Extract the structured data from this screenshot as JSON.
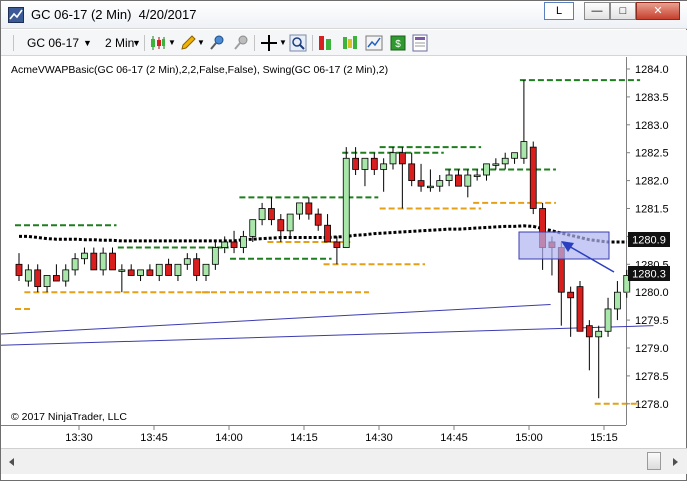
{
  "window": {
    "title": "GC 06-17 (2 Min)  4/20/2017",
    "buttons": {
      "layout": "L",
      "minimize": "—",
      "maximize": "□",
      "close": "✕"
    }
  },
  "toolbar": {
    "instrument": "GC 06-17",
    "interval": "2 Min",
    "icons": [
      "candlestick-style-icon",
      "pencil-draw-icon",
      "attach-indicator-icon",
      "detach-icon",
      "crosshair-icon",
      "zoom-icon",
      "indicators-icon",
      "strategies-icon",
      "chart-trader-icon",
      "data-box-icon",
      "properties-icon"
    ]
  },
  "chart": {
    "indicator_label": "AcmeVWAPBasic(GC 06-17 (2 Min),2,2,False,False), Swing(GC 06-17 (2 Min),2)",
    "copyright": "© 2017 NinjaTrader, LLC",
    "price_labels": [
      "1284.0",
      "1283.5",
      "1283.0",
      "1282.5",
      "1282.0",
      "1281.5",
      "1281.0",
      "1280.5",
      "1280.0",
      "1279.5",
      "1279.0",
      "1278.5",
      "1278.0"
    ],
    "time_labels": [
      "13:30",
      "13:45",
      "14:00",
      "14:15",
      "14:30",
      "14:45",
      "15:00",
      "15:15"
    ],
    "vwap_marker": "1280.9",
    "last_price_marker": "1280.3",
    "colors": {
      "up_candle": "#a9e6a9",
      "down_candle": "#d91e1e",
      "swing_high": "#1e7d1e",
      "swing_low": "#e6a017",
      "vwap": "#000000",
      "band_line": "#3b3bb0",
      "highlight_rect": "#aeb4f0"
    }
  },
  "chart_data": {
    "type": "candlestick",
    "instrument": "GC 06-17",
    "x_labels": [
      "13:30",
      "13:45",
      "14:00",
      "14:15",
      "14:30",
      "14:45",
      "15:00",
      "15:15"
    ],
    "ylim": [
      1277.8,
      1284.2
    ],
    "candles": [
      {
        "o": 1280.5,
        "h": 1280.7,
        "l": 1280.2,
        "c": 1280.3
      },
      {
        "o": 1280.2,
        "h": 1280.5,
        "l": 1280.1,
        "c": 1280.4
      },
      {
        "o": 1280.4,
        "h": 1280.5,
        "l": 1280.0,
        "c": 1280.1
      },
      {
        "o": 1280.1,
        "h": 1280.3,
        "l": 1280.0,
        "c": 1280.3
      },
      {
        "o": 1280.3,
        "h": 1280.5,
        "l": 1280.2,
        "c": 1280.2
      },
      {
        "o": 1280.2,
        "h": 1280.5,
        "l": 1280.1,
        "c": 1280.4
      },
      {
        "o": 1280.4,
        "h": 1280.7,
        "l": 1280.3,
        "c": 1280.6
      },
      {
        "o": 1280.6,
        "h": 1280.8,
        "l": 1280.5,
        "c": 1280.7
      },
      {
        "o": 1280.7,
        "h": 1280.8,
        "l": 1280.4,
        "c": 1280.4
      },
      {
        "o": 1280.4,
        "h": 1280.8,
        "l": 1280.3,
        "c": 1280.7
      },
      {
        "o": 1280.7,
        "h": 1280.8,
        "l": 1280.4,
        "c": 1280.4
      },
      {
        "o": 1280.4,
        "h": 1280.5,
        "l": 1280.0,
        "c": 1280.4
      },
      {
        "o": 1280.4,
        "h": 1280.5,
        "l": 1280.3,
        "c": 1280.3
      },
      {
        "o": 1280.3,
        "h": 1280.4,
        "l": 1280.2,
        "c": 1280.4
      },
      {
        "o": 1280.4,
        "h": 1280.5,
        "l": 1280.3,
        "c": 1280.3
      },
      {
        "o": 1280.3,
        "h": 1280.5,
        "l": 1280.2,
        "c": 1280.5
      },
      {
        "o": 1280.5,
        "h": 1280.6,
        "l": 1280.3,
        "c": 1280.3
      },
      {
        "o": 1280.3,
        "h": 1280.5,
        "l": 1280.2,
        "c": 1280.5
      },
      {
        "o": 1280.5,
        "h": 1280.7,
        "l": 1280.4,
        "c": 1280.6
      },
      {
        "o": 1280.6,
        "h": 1280.7,
        "l": 1280.2,
        "c": 1280.3
      },
      {
        "o": 1280.3,
        "h": 1280.5,
        "l": 1280.2,
        "c": 1280.5
      },
      {
        "o": 1280.5,
        "h": 1280.9,
        "l": 1280.4,
        "c": 1280.8
      },
      {
        "o": 1280.8,
        "h": 1281.0,
        "l": 1280.7,
        "c": 1280.9
      },
      {
        "o": 1280.9,
        "h": 1281.1,
        "l": 1280.7,
        "c": 1280.8
      },
      {
        "o": 1280.8,
        "h": 1281.1,
        "l": 1280.7,
        "c": 1281.0
      },
      {
        "o": 1281.0,
        "h": 1281.3,
        "l": 1280.9,
        "c": 1281.3
      },
      {
        "o": 1281.3,
        "h": 1281.6,
        "l": 1281.2,
        "c": 1281.5
      },
      {
        "o": 1281.5,
        "h": 1281.7,
        "l": 1281.2,
        "c": 1281.3
      },
      {
        "o": 1281.3,
        "h": 1281.4,
        "l": 1280.9,
        "c": 1281.1
      },
      {
        "o": 1281.1,
        "h": 1281.4,
        "l": 1281.0,
        "c": 1281.4
      },
      {
        "o": 1281.4,
        "h": 1281.6,
        "l": 1281.3,
        "c": 1281.6
      },
      {
        "o": 1281.6,
        "h": 1281.7,
        "l": 1281.3,
        "c": 1281.4
      },
      {
        "o": 1281.4,
        "h": 1281.5,
        "l": 1281.1,
        "c": 1281.2
      },
      {
        "o": 1281.2,
        "h": 1281.4,
        "l": 1280.9,
        "c": 1280.9
      },
      {
        "o": 1280.9,
        "h": 1281.0,
        "l": 1280.5,
        "c": 1280.8
      },
      {
        "o": 1280.8,
        "h": 1282.6,
        "l": 1280.8,
        "c": 1282.4
      },
      {
        "o": 1282.4,
        "h": 1282.6,
        "l": 1282.1,
        "c": 1282.2
      },
      {
        "o": 1282.2,
        "h": 1282.4,
        "l": 1281.9,
        "c": 1282.4
      },
      {
        "o": 1282.4,
        "h": 1282.5,
        "l": 1282.1,
        "c": 1282.2
      },
      {
        "o": 1282.2,
        "h": 1282.4,
        "l": 1281.8,
        "c": 1282.3
      },
      {
        "o": 1282.3,
        "h": 1282.6,
        "l": 1282.2,
        "c": 1282.5
      },
      {
        "o": 1282.5,
        "h": 1282.6,
        "l": 1281.5,
        "c": 1282.3
      },
      {
        "o": 1282.3,
        "h": 1282.5,
        "l": 1281.9,
        "c": 1282.0
      },
      {
        "o": 1282.0,
        "h": 1282.3,
        "l": 1281.8,
        "c": 1281.9
      },
      {
        "o": 1281.9,
        "h": 1282.2,
        "l": 1281.8,
        "c": 1281.9
      },
      {
        "o": 1281.9,
        "h": 1282.1,
        "l": 1281.8,
        "c": 1282.0
      },
      {
        "o": 1282.0,
        "h": 1282.2,
        "l": 1281.9,
        "c": 1282.1
      },
      {
        "o": 1282.1,
        "h": 1282.2,
        "l": 1281.9,
        "c": 1281.9
      },
      {
        "o": 1281.9,
        "h": 1282.2,
        "l": 1281.7,
        "c": 1282.1
      },
      {
        "o": 1282.1,
        "h": 1282.2,
        "l": 1282.0,
        "c": 1282.1
      },
      {
        "o": 1282.1,
        "h": 1282.3,
        "l": 1282.0,
        "c": 1282.3
      },
      {
        "o": 1282.3,
        "h": 1282.4,
        "l": 1282.2,
        "c": 1282.3
      },
      {
        "o": 1282.3,
        "h": 1282.5,
        "l": 1282.2,
        "c": 1282.4
      },
      {
        "o": 1282.4,
        "h": 1282.5,
        "l": 1282.3,
        "c": 1282.5
      },
      {
        "o": 1282.4,
        "h": 1283.8,
        "l": 1282.3,
        "c": 1282.7
      },
      {
        "o": 1282.6,
        "h": 1282.7,
        "l": 1281.4,
        "c": 1281.5
      },
      {
        "o": 1281.5,
        "h": 1281.6,
        "l": 1280.4,
        "c": 1280.8
      },
      {
        "o": 1280.9,
        "h": 1281.0,
        "l": 1280.3,
        "c": 1280.8
      },
      {
        "o": 1280.8,
        "h": 1280.9,
        "l": 1279.4,
        "c": 1280.0
      },
      {
        "o": 1280.0,
        "h": 1280.1,
        "l": 1279.2,
        "c": 1279.9
      },
      {
        "o": 1280.1,
        "h": 1280.2,
        "l": 1279.6,
        "c": 1279.3
      },
      {
        "o": 1279.4,
        "h": 1279.5,
        "l": 1278.6,
        "c": 1279.2
      },
      {
        "o": 1279.2,
        "h": 1279.4,
        "l": 1278.1,
        "c": 1279.3
      },
      {
        "o": 1279.3,
        "h": 1279.9,
        "l": 1279.2,
        "c": 1279.7
      },
      {
        "o": 1279.7,
        "h": 1280.2,
        "l": 1279.5,
        "c": 1280.0
      },
      {
        "o": 1280.0,
        "h": 1280.4,
        "l": 1279.9,
        "c": 1280.3
      }
    ],
    "swing_highs": [
      {
        "price": 1281.2,
        "from": 0,
        "to": 10
      },
      {
        "price": 1280.8,
        "from": 11,
        "to": 22
      },
      {
        "price": 1280.6,
        "from": 23,
        "to": 33
      },
      {
        "price": 1281.7,
        "from": 24,
        "to": 38
      },
      {
        "price": 1282.5,
        "from": 35,
        "to": 45
      },
      {
        "price": 1282.6,
        "from": 39,
        "to": 49
      },
      {
        "price": 1282.2,
        "from": 46,
        "to": 57
      },
      {
        "price": 1283.8,
        "from": 54,
        "to": 66
      }
    ],
    "swing_lows": [
      {
        "price": 1279.7,
        "from": 0,
        "to": 1
      },
      {
        "price": 1280.0,
        "from": 1,
        "to": 20
      },
      {
        "price": 1280.0,
        "from": 20,
        "to": 37
      },
      {
        "price": 1280.9,
        "from": 27,
        "to": 35
      },
      {
        "price": 1280.5,
        "from": 33,
        "to": 43
      },
      {
        "price": 1281.5,
        "from": 39,
        "to": 49
      },
      {
        "price": 1281.6,
        "from": 49,
        "to": 57
      },
      {
        "price": 1278.0,
        "from": 62,
        "to": 66
      }
    ],
    "vwap_series": [
      1281.0,
      1281.0,
      1280.98,
      1280.96,
      1280.95,
      1280.95,
      1280.95,
      1280.94,
      1280.94,
      1280.93,
      1280.93,
      1280.92,
      1280.92,
      1280.92,
      1280.92,
      1280.92,
      1280.92,
      1280.92,
      1280.92,
      1280.92,
      1280.92,
      1280.92,
      1280.92,
      1280.92,
      1280.94,
      1280.95,
      1280.96,
      1280.97,
      1280.98,
      1280.98,
      1280.98,
      1280.98,
      1280.98,
      1280.98,
      1280.99,
      1281.0,
      1281.02,
      1281.03,
      1281.05,
      1281.06,
      1281.07,
      1281.08,
      1281.09,
      1281.1,
      1281.11,
      1281.12,
      1281.13,
      1281.13,
      1281.14,
      1281.15,
      1281.16,
      1281.17,
      1281.18,
      1281.18,
      1281.19,
      1281.18,
      1281.14,
      1281.1,
      1281.06,
      1281.02,
      1280.98,
      1280.94,
      1280.92,
      1280.9,
      1280.9,
      1280.9
    ],
    "band_lines": [
      {
        "from": [
          0,
          1279.25
        ],
        "to": [
          56,
          1279.78
        ]
      },
      {
        "from": [
          0,
          1279.05
        ],
        "to": [
          67,
          1279.4
        ]
      }
    ]
  }
}
